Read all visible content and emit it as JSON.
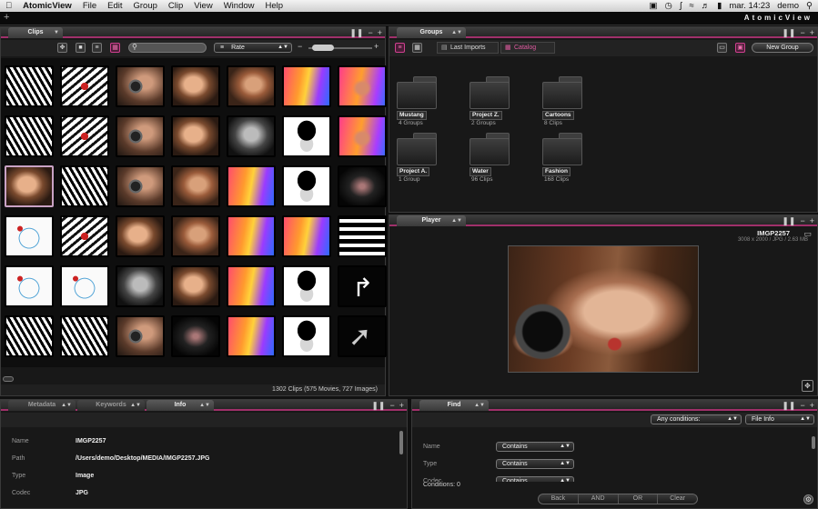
{
  "menubar": {
    "app": "AtomicView",
    "items": [
      "File",
      "Edit",
      "Group",
      "Clip",
      "View",
      "Window",
      "Help"
    ],
    "clock": "mar. 14:23",
    "user": "demo"
  },
  "appbar": {
    "logo": "AtomicView",
    "add": "+"
  },
  "clips": {
    "tab": "Clips",
    "sort_label": "Rate",
    "search_placeholder": "",
    "status": "1302 Clips  (575 Movies, 727 Images)",
    "thumb_rows": [
      [
        "bw",
        "bwr",
        "cam",
        "face",
        "face2",
        "color",
        "color2"
      ],
      [
        "bw",
        "bwr",
        "cam",
        "face",
        "gray",
        "hat",
        "color2"
      ],
      [
        "face",
        "bw",
        "cam",
        "face2",
        "color",
        "hat",
        "dark"
      ],
      [
        "circle",
        "bwr",
        "face",
        "face2",
        "color",
        "color",
        "stripes"
      ],
      [
        "circle",
        "circle",
        "gray",
        "face",
        "color",
        "hat",
        "arrow"
      ],
      [
        "bw",
        "bw",
        "cam",
        "dark",
        "color",
        "hat",
        "arrow2"
      ]
    ],
    "selected_index": 14
  },
  "groups": {
    "tab": "Groups",
    "last_imports": "Last Imports",
    "catalog": "Catalog",
    "new_group": "New Group",
    "folders": [
      {
        "name": "Mustang",
        "sub": "4 Groups"
      },
      {
        "name": "Project Z.",
        "sub": "2 Groups"
      },
      {
        "name": "Cartoons",
        "sub": "8 Clips"
      },
      {
        "name": "Project A.",
        "sub": "1 Group"
      },
      {
        "name": "Water",
        "sub": "96 Clips"
      },
      {
        "name": "Fashion",
        "sub": "168 Clips"
      }
    ]
  },
  "player": {
    "tab": "Player",
    "filename": "IMGP2257",
    "details": "3008 x 2000 / JPG / 2.63 MB"
  },
  "info": {
    "tabs": [
      "Metadata",
      "Keywords",
      "Info"
    ],
    "rows": [
      {
        "label": "Name",
        "value": "IMGP2257"
      },
      {
        "label": "Path",
        "value": "/Users/demo/Desktop/MEDIA/IMGP2257.JPG"
      },
      {
        "label": "Type",
        "value": "Image"
      },
      {
        "label": "Codec",
        "value": "JPG"
      }
    ]
  },
  "find": {
    "tab": "Find",
    "any_conditions": "Any conditions:",
    "file_info": "File Info",
    "rows": [
      {
        "label": "Name",
        "op": "Contains"
      },
      {
        "label": "Type",
        "op": "Contains"
      },
      {
        "label": "Codec",
        "op": "Contains"
      }
    ],
    "conditions_label": "Conditions: 0",
    "buttons": [
      "Back",
      "AND",
      "OR",
      "Clear"
    ]
  },
  "colors": {
    "accent": "#a0306a",
    "panel": "#181818"
  }
}
